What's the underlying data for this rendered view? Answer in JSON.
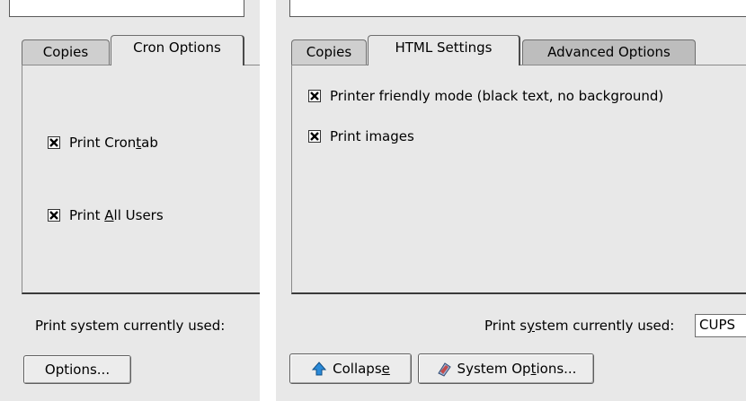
{
  "left_panel": {
    "tabs": [
      {
        "label": "Copies"
      },
      {
        "label": "Cron Options"
      }
    ],
    "active_tab": "Cron Options",
    "checkboxes": [
      {
        "pre": "Print Cron",
        "accel": "t",
        "post": "ab",
        "checked": true
      },
      {
        "pre": "Print ",
        "accel": "A",
        "post": "ll Users",
        "checked": true
      }
    ],
    "status_label": "Print system currently used:",
    "options_button": "Options..."
  },
  "right_panel": {
    "tabs": [
      {
        "label": "Copies"
      },
      {
        "label": "HTML Settings"
      },
      {
        "label": "Advanced Options"
      }
    ],
    "active_tab": "HTML Settings",
    "checkboxes": [
      {
        "label": "Printer friendly mode (black text, no background)",
        "checked": true
      },
      {
        "label": "Print images",
        "checked": true
      }
    ],
    "status": {
      "pre": "Print s",
      "accel": "y",
      "post": "stem currently used:"
    },
    "print_system_value": "CUPS",
    "collapse_button": {
      "pre": "Collaps",
      "accel": "e",
      "post": "",
      "icon": "up-arrow-icon"
    },
    "system_options_button": {
      "pre": "System Op",
      "accel": "t",
      "post": "ions...",
      "icon": "printer-icon"
    }
  },
  "colors": {
    "background": "#e8e8e8",
    "tab_inactive": "#cfcfcf",
    "tab_advanced": "#bdbdbd",
    "arrow_icon": "#2a8ad8"
  }
}
